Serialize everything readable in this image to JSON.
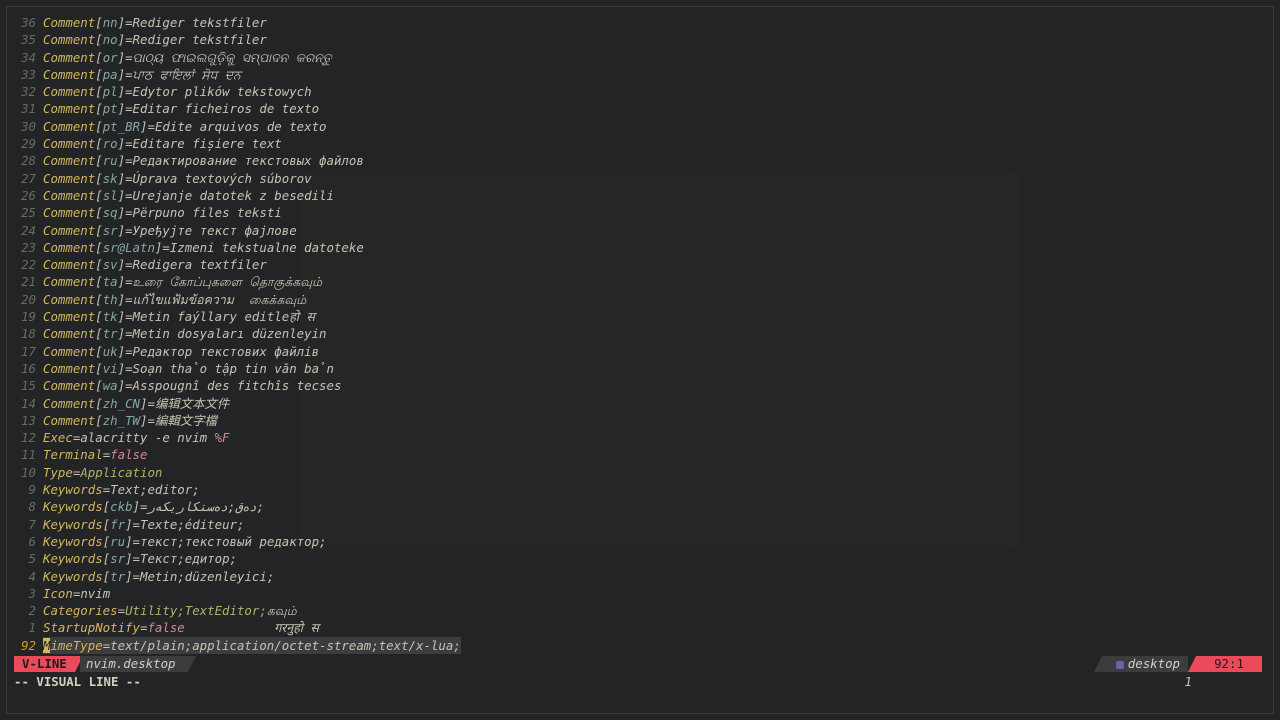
{
  "editor": {
    "lines": [
      {
        "ln": "36",
        "key": "Comment",
        "loc": "nn",
        "val": "Rediger tekstfiler"
      },
      {
        "ln": "35",
        "key": "Comment",
        "loc": "no",
        "val": "Rediger tekstfiler"
      },
      {
        "ln": "34",
        "key": "Comment",
        "loc": "or",
        "val": "ପାଠ୍ୟ ଫାଇଲଗୁଡ଼ିକୁ ସମ୍ପାଦନ କରନ୍ତୁ"
      },
      {
        "ln": "33",
        "key": "Comment",
        "loc": "pa",
        "val": "ਪਾਠ ਫਾਇਲਾਂ ਸੋਧ ਦਨ"
      },
      {
        "ln": "32",
        "key": "Comment",
        "loc": "pl",
        "val": "Edytor plików tekstowych"
      },
      {
        "ln": "31",
        "key": "Comment",
        "loc": "pt",
        "val": "Editar ficheiros de texto"
      },
      {
        "ln": "30",
        "key": "Comment",
        "loc": "pt_BR",
        "val": "Edite arquivos de texto"
      },
      {
        "ln": "29",
        "key": "Comment",
        "loc": "ro",
        "val": "Editare fișiere text"
      },
      {
        "ln": "28",
        "key": "Comment",
        "loc": "ru",
        "val": "Редактирование текстовых файлов"
      },
      {
        "ln": "27",
        "key": "Comment",
        "loc": "sk",
        "val": "Úprava textových súborov"
      },
      {
        "ln": "26",
        "key": "Comment",
        "loc": "sl",
        "val": "Urejanje datotek z besedili"
      },
      {
        "ln": "25",
        "key": "Comment",
        "loc": "sq",
        "val": "Përpuno files teksti"
      },
      {
        "ln": "24",
        "key": "Comment",
        "loc": "sr",
        "val": "Уређујте текст фајлове"
      },
      {
        "ln": "23",
        "key": "Comment",
        "loc": "sr@Latn",
        "val": "Izmeni tekstualne datoteke"
      },
      {
        "ln": "22",
        "key": "Comment",
        "loc": "sv",
        "val": "Redigera textfiler"
      },
      {
        "ln": "21",
        "key": "Comment",
        "loc": "ta",
        "val": "உரை கோப்புகளை தொகுக்கவும்"
      },
      {
        "ln": "20",
        "key": "Comment",
        "loc": "th",
        "val": "แก้ไขแฟ้มข้อความ  கைக்கவும்"
      },
      {
        "ln": "19",
        "key": "Comment",
        "loc": "tk",
        "val": "Metin faýllary editleहो स"
      },
      {
        "ln": "18",
        "key": "Comment",
        "loc": "tr",
        "val": "Metin dosyaları düzenleyin"
      },
      {
        "ln": "17",
        "key": "Comment",
        "loc": "uk",
        "val": "Редактор текстових файлів"
      },
      {
        "ln": "16",
        "key": "Comment",
        "loc": "vi",
        "val": "Soạn thảo tập tin văn bản"
      },
      {
        "ln": "15",
        "key": "Comment",
        "loc": "wa",
        "val": "Asspougnî des fitchîs tecses"
      },
      {
        "ln": "14",
        "key": "Comment",
        "loc": "zh_CN",
        "val": "编辑文本文件"
      },
      {
        "ln": "13",
        "key": "Comment",
        "loc": "zh_TW",
        "val": "編輯文字檔"
      },
      {
        "ln": "12",
        "key": "Exec",
        "val": "alacritty -e nvim ",
        "pct": "%F"
      },
      {
        "ln": "11",
        "key": "Terminal",
        "val_false": "false"
      },
      {
        "ln": "10",
        "key": "Type",
        "val_green": "Application"
      },
      {
        "ln": "9",
        "key": "Keywords",
        "val": "Text;editor;"
      },
      {
        "ln": "8",
        "key": "Keywords",
        "loc": "ckb",
        "val": "دەق;دەستکاریکەر;"
      },
      {
        "ln": "7",
        "key": "Keywords",
        "loc": "fr",
        "val": "Texte;éditeur;"
      },
      {
        "ln": "6",
        "key": "Keywords",
        "loc": "ru",
        "val": "текст;текстовый редактор;"
      },
      {
        "ln": "5",
        "key": "Keywords",
        "loc": "sr",
        "val": "Текст;едитор;"
      },
      {
        "ln": "4",
        "key": "Keywords",
        "loc": "tr",
        "val": "Metin;düzenleyici;"
      },
      {
        "ln": "3",
        "key": "Icon",
        "val": "nvim"
      },
      {
        "ln": "2",
        "key": "Categories",
        "val_green": "Utility;TextEditor;",
        "val": "கவும்"
      },
      {
        "ln": "1",
        "key": "StartupNotify",
        "val_false": "false",
        "val": "            गरनुहो स"
      },
      {
        "ln": "92",
        "key": "MimeType",
        "val": "text/plain;application/octet-stream;text/x-lua;",
        "current": true
      }
    ]
  },
  "statusline": {
    "mode": "V-LINE",
    "filename": "nvim.desktop",
    "filetype": "desktop",
    "position": "92:1"
  },
  "cmdline": {
    "text": "-- VISUAL LINE --",
    "count": "1"
  },
  "colors": {
    "background": "#232425",
    "mode_accent": "#ea4a5a",
    "key_yellow": "#d3b461",
    "locale_teal": "#86a7a9",
    "boolean_pink": "#d3869b",
    "type_green": "#a9b665"
  }
}
